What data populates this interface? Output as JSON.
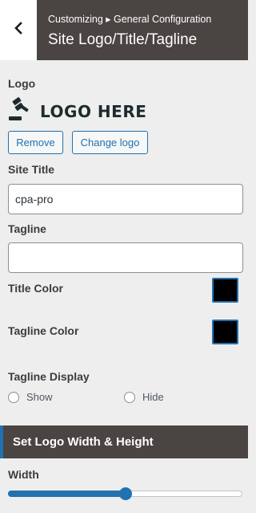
{
  "header": {
    "breadcrumb": "Customizing ▸ General Configuration",
    "title": "Site Logo/Title/Tagline",
    "back_icon": "chevron-left-icon"
  },
  "logo": {
    "label": "Logo",
    "preview_text": "LOGO HERE",
    "preview_icon": "gavel-icon",
    "remove_label": "Remove",
    "change_label": "Change logo"
  },
  "site_title": {
    "label": "Site Title",
    "value": "cpa-pro"
  },
  "tagline": {
    "label": "Tagline",
    "value": ""
  },
  "title_color": {
    "label": "Title Color",
    "value": "#000000"
  },
  "tagline_color": {
    "label": "Tagline Color",
    "value": "#000000"
  },
  "tagline_display": {
    "label": "Tagline Display",
    "options": [
      {
        "label": "Show"
      },
      {
        "label": "Hide"
      }
    ]
  },
  "logo_size": {
    "header": "Set Logo Width & Height",
    "width_label": "Width",
    "width_value_fraction": 0.5
  },
  "colors": {
    "accent": "#2271b1",
    "header_bg": "#4a4542",
    "panel_bg": "#eeeeee"
  }
}
